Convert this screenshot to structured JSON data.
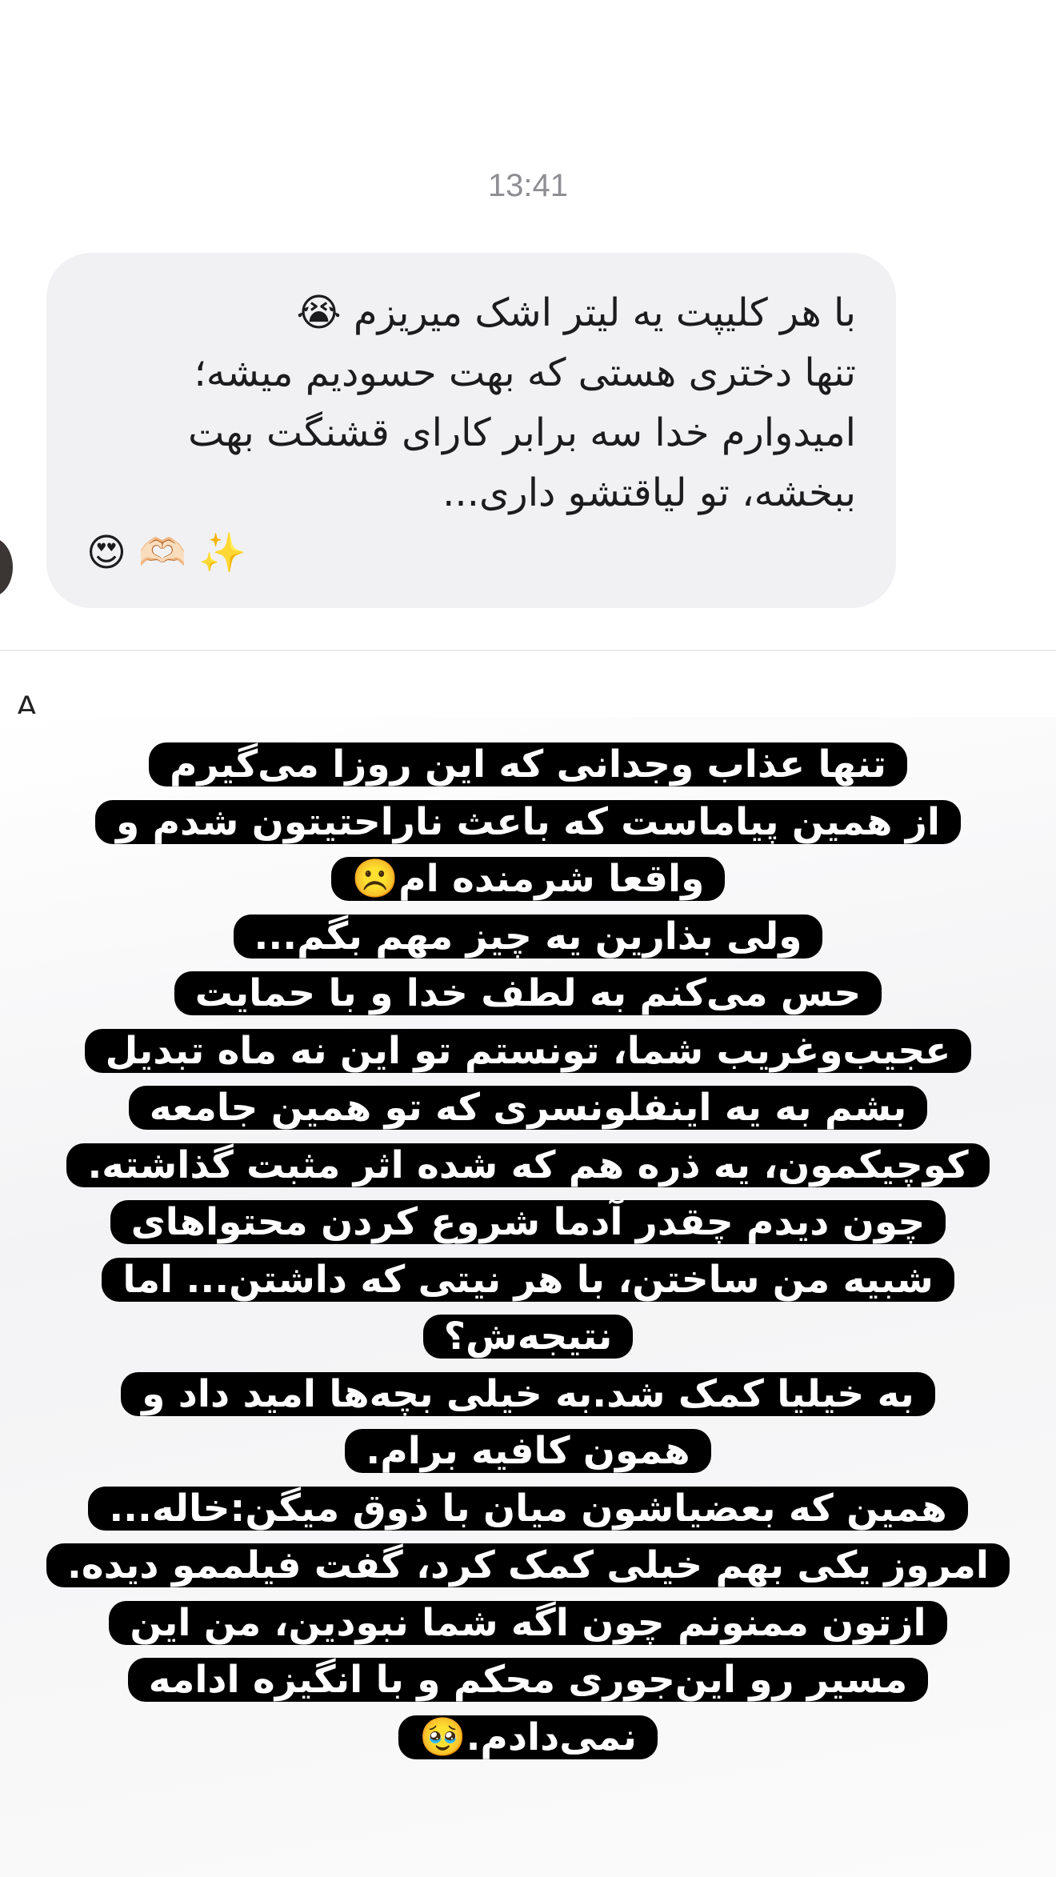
{
  "chat": {
    "timestamp": "13:41",
    "message_lines": [
      "با هر کلیپت یه لیتر اشک میریزم 😭",
      "تنها دختری هستی که بهت حسودیم میشه؛",
      "امیدوارم خدا سه برابر کارای قشنگت بهت",
      "ببخشه، تو لیاقتشو داری...",
      "😍 🫶🏻 ✨"
    ]
  },
  "story": {
    "partial_label": "A",
    "caption_lines": [
      "تنها عذاب وجدانی که این روزا می‌گیرم",
      "از همین پیاماست که باعث ناراحتیتون شدم و",
      "واقعا شرمنده ام☹️",
      "ولی بذارین یه چیز مهم بگم...",
      "حس می‌کنم به لطف خدا و با حمایت",
      "عجیب‌وغریب شما، تونستم تو این نه ماه تبدیل",
      "بشم به یه اینفلونسری که تو همین جامعه",
      "کوچیکمون، یه ذره هم که شده اثر مثبت گذاشته.",
      "چون دیدم چقدر آدما شروع کردن محتواهای",
      "شبیه من ساختن، با هر نیتی که داشتن... اما",
      "نتیجه‌ش؟",
      "به خیلیا کمک شد.به خیلی بچه‌ها امید داد و",
      "همون کافیه برام.",
      "همین که بعضیاشون میان با ذوق میگن:خاله...",
      "امروز یکی بهم خیلی کمک کرد، گفت فیلممو دیده.",
      "ازتون ممنونم چون اگه شما نبودین، من این",
      "مسیر رو این‌جوری محکم و با انگیزه ادامه",
      "نمی‌دادم.🥹"
    ]
  }
}
